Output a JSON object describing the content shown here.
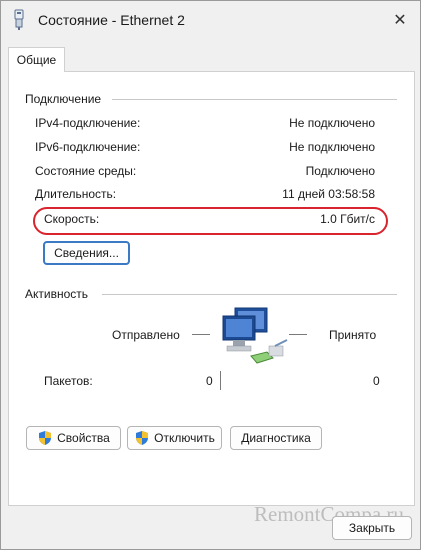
{
  "window": {
    "title": "Состояние - Ethernet 2",
    "close_glyph": "✕"
  },
  "tabs": [
    {
      "label": "Общие",
      "selected": true
    }
  ],
  "connection": {
    "group_title": "Подключение",
    "rows": [
      {
        "label": "IPv4-подключение:",
        "value": "Не подключено"
      },
      {
        "label": "IPv6-подключение:",
        "value": "Не подключено"
      },
      {
        "label": "Состояние среды:",
        "value": "Подключено"
      },
      {
        "label": "Длительность:",
        "value": "11 дней 03:58:58"
      },
      {
        "label": "Скорость:",
        "value": "1.0 Гбит/с"
      }
    ],
    "details_button": "Сведения..."
  },
  "activity": {
    "group_title": "Активность",
    "sent_label": "Отправлено",
    "received_label": "Принято",
    "packets_label": "Пакетов:",
    "packets_sent": "0",
    "packets_received": "0"
  },
  "buttons": {
    "properties": "Свойства",
    "disable": "Отключить",
    "diagnose": "Диагностика",
    "close": "Закрыть"
  },
  "watermark": "RemontCompa.ru",
  "colors": {
    "highlight": "#d9232d",
    "primary_border": "#3b79c4"
  }
}
